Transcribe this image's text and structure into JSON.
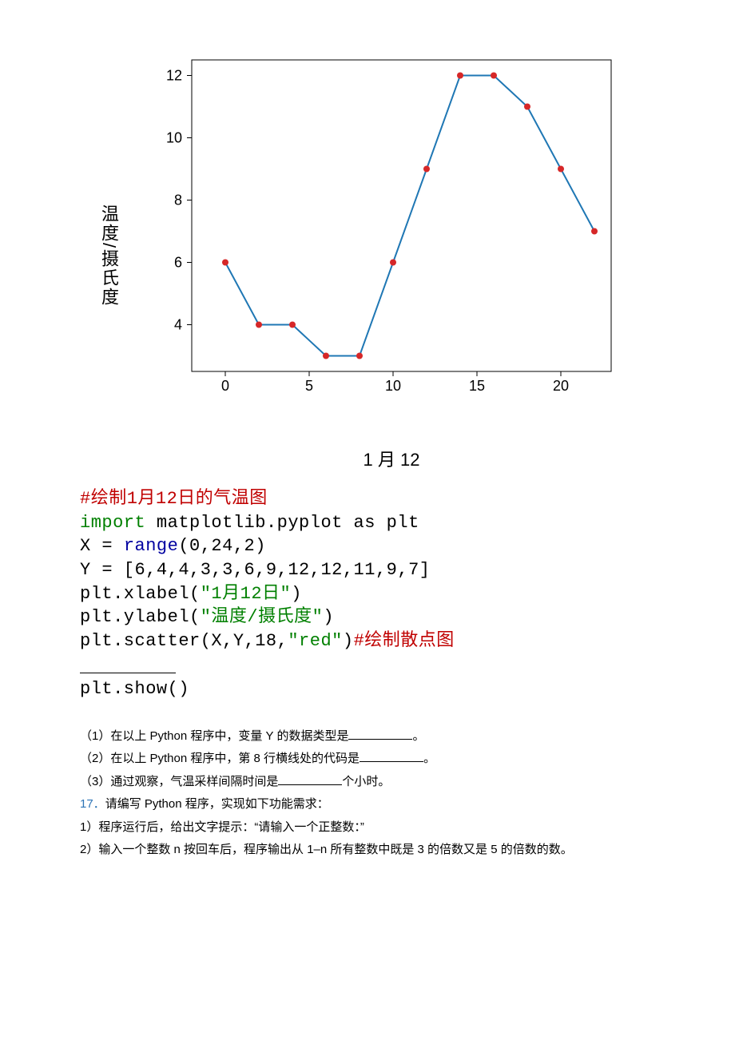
{
  "chart_data": {
    "type": "line",
    "x": [
      0,
      2,
      4,
      6,
      8,
      10,
      12,
      14,
      16,
      18,
      20,
      22
    ],
    "y": [
      6,
      4,
      4,
      3,
      3,
      6,
      9,
      12,
      12,
      11,
      9,
      7
    ],
    "xlabel": "1 月 12",
    "ylabel": "温度/摄氏度",
    "xlim": [
      -2,
      23
    ],
    "ylim": [
      2.5,
      12.5
    ],
    "xticks": [
      0,
      5,
      10,
      15,
      20
    ],
    "yticks": [
      4,
      6,
      8,
      10,
      12
    ],
    "marker_color": "#d62728",
    "line_color": "#1f77b4"
  },
  "code": {
    "line1_comment": "#绘制1月12日的气温图",
    "line2_pre": "import",
    "line2_rest": " matplotlib.pyplot as plt",
    "line3_pre": "X = ",
    "line3_func": "range",
    "line3_args": "(0,24,2)",
    "line4": "Y = [6,4,4,3,3,6,9,12,12,11,9,7]",
    "line5_pre": "plt.xlabel(",
    "line5_str": "\"1月12日\"",
    "line5_post": ")",
    "line6_pre": "plt.ylabel(",
    "line6_str": "\"温度/摄氏度\"",
    "line6_post": ")",
    "line7_pre": "plt.scatter(X,Y,18,",
    "line7_str": "\"red\"",
    "line7_post": ")",
    "line7_comment": "#绘制散点图",
    "line9": "plt.show()"
  },
  "questions": {
    "q1_pre": "（1）在以上 Python 程序中，变量 Y 的数据类型是",
    "q1_post": "。",
    "q2_pre": "（2）在以上 Python 程序中，第 8 行横线处的代码是",
    "q2_post": "。",
    "q3_pre": "（3）通过观察，气温采样间隔时间是",
    "q3_post": "个小时。",
    "q17_num": "17．",
    "q17_text": "请编写 Python 程序，实现如下功能需求：",
    "q17_1": "1）程序运行后，给出文字提示：“请输入一个正整数：”",
    "q17_2": "2）输入一个整数 n 按回车后，程序输出从 1–n 所有整数中既是 3 的倍数又是 5 的倍数的数。"
  }
}
